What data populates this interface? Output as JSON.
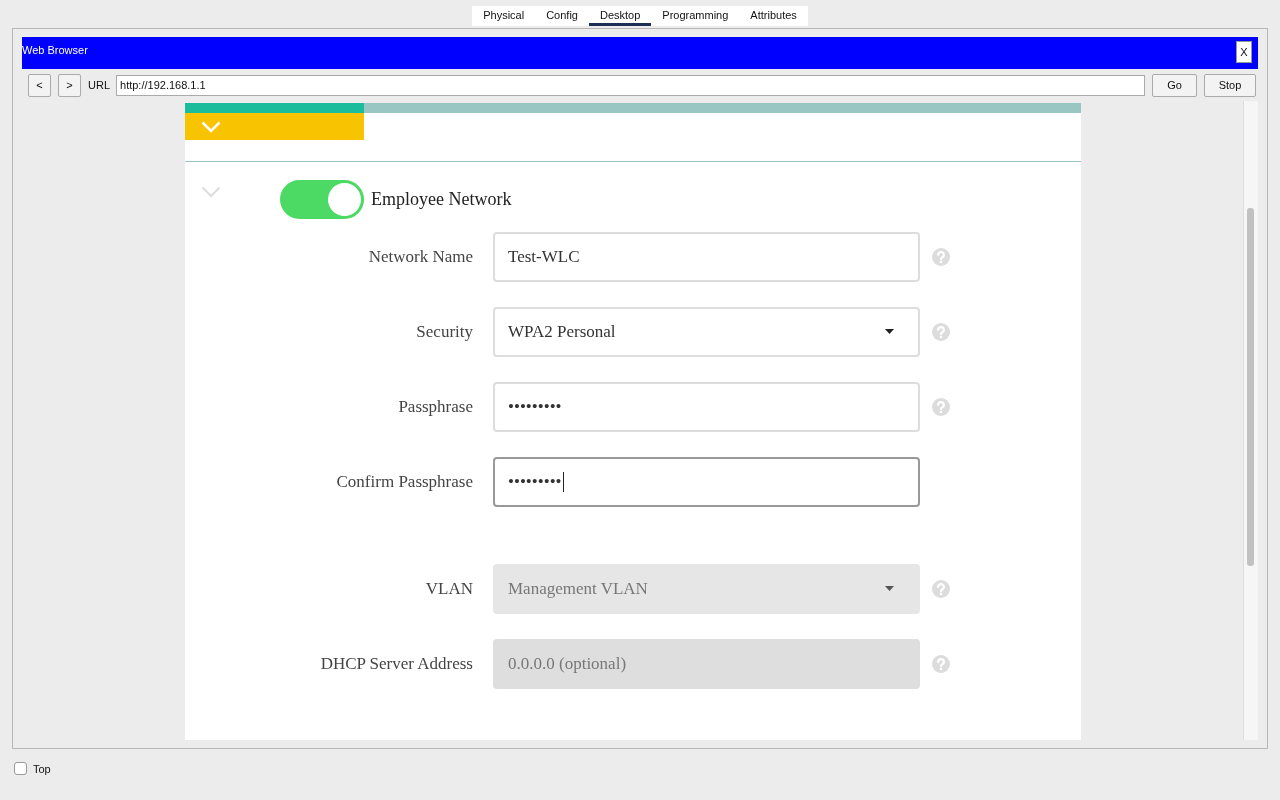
{
  "device_tabs": [
    {
      "label": "Physical",
      "selected": false
    },
    {
      "label": "Config",
      "selected": false
    },
    {
      "label": "Desktop",
      "selected": true
    },
    {
      "label": "Programming",
      "selected": false
    },
    {
      "label": "Attributes",
      "selected": false
    }
  ],
  "browser": {
    "title": "Web Browser",
    "close": "X",
    "back": "<",
    "forward": ">",
    "url_label": "URL",
    "url": "http://192.168.1.1",
    "go": "Go",
    "stop": "Stop"
  },
  "wizard": {
    "progress": {
      "level": 0.2
    }
  },
  "network": {
    "name": "Employee Network",
    "on": true,
    "security_fields": [
      {
        "kind": "text",
        "label": "Network Name",
        "value": "Test-WLC",
        "help": true,
        "disabled": false,
        "focused": false
      },
      {
        "kind": "select",
        "label": "Security",
        "value": "WPA2 Personal",
        "help": true,
        "disabled": false,
        "focused": false
      },
      {
        "kind": "password",
        "label": "Passphrase",
        "value": "•••••••••",
        "help": true,
        "disabled": false,
        "focused": false
      },
      {
        "kind": "password",
        "label": "Confirm Passphrase",
        "value": "•••••••••",
        "help": false,
        "disabled": false,
        "focused": true
      }
    ],
    "vlan_fields": [
      {
        "kind": "select",
        "label": "VLAN",
        "value": "Management VLAN",
        "help": true,
        "disabled": true,
        "focused": false
      },
      {
        "kind": "text",
        "label": "DHCP Server Address",
        "placeholder": "0.0.0.0 (optional)",
        "help": true,
        "disabled": true,
        "focused": false
      }
    ]
  },
  "top_checkbox": {
    "label": "Top",
    "checked": false
  }
}
